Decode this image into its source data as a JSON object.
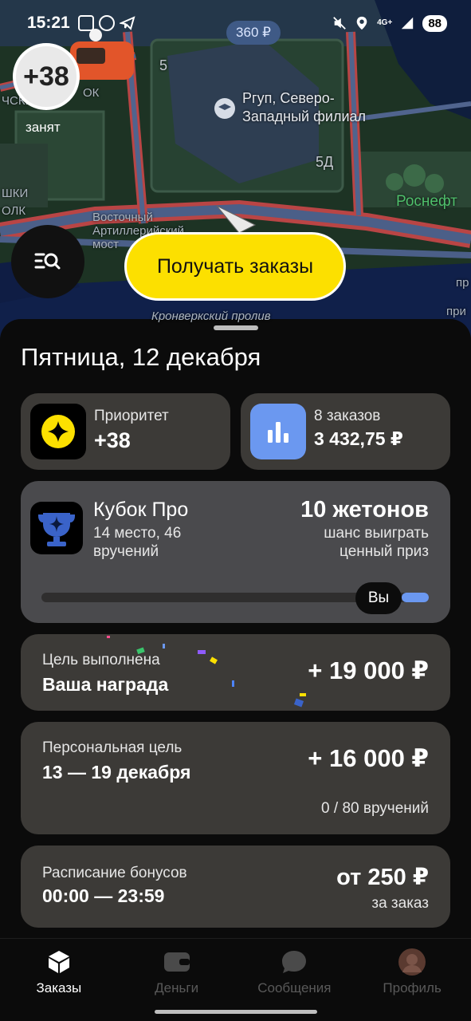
{
  "status_bar": {
    "time": "15:21",
    "battery": "88",
    "network": "4G+"
  },
  "map": {
    "price_pill": "360 ₽",
    "driver_status_value": "+38",
    "driver_status_label": "занят",
    "labels": {
      "number_5": "5",
      "university": "Ргуп, Северо-\nЗападный филиал",
      "building_5d": "5Д",
      "rosneft": "Роснефт",
      "street": "Восточный\nАртиллерийский\nмост",
      "strait": "Кронверкский пролив",
      "left_fragment_1": "ЧСКИ",
      "left_fragment_2": "ОК",
      "left_fragment_3": "ШКИ",
      "left_fragment_4": "ОЛК",
      "right_fragment_1": "пр",
      "right_fragment_2": "при"
    },
    "get_orders_button": "Получать заказы"
  },
  "sheet": {
    "date_title": "Пятница, 12 декабря",
    "priority": {
      "label": "Приоритет",
      "value": "+38"
    },
    "orders": {
      "label": "8 заказов",
      "value": "3 432,75 ₽"
    },
    "cup": {
      "title": "Кубок Про",
      "subtitle": "14 место, 46\nвручений",
      "tokens": "10 жетонов",
      "tokens_desc": "шанс выиграть\nценный приз",
      "you_badge": "Вы",
      "progress_fraction": 0.07
    },
    "goal_done": {
      "label": "Цель выполнена",
      "title": "Ваша награда",
      "amount": "+ 19 000 ₽"
    },
    "personal_goal": {
      "label": "Персональная цель",
      "dates": "13 — 19 декабря",
      "amount": "+ 16 000 ₽",
      "progress": "0 / 80 вручений"
    },
    "schedule": {
      "label": "Расписание бонусов",
      "time": "00:00 — 23:59",
      "amount": "от 250 ₽",
      "per": "за заказ"
    }
  },
  "bottom_nav": {
    "items": [
      {
        "label": "Заказы",
        "active": true
      },
      {
        "label": "Деньги",
        "active": false
      },
      {
        "label": "Сообщения",
        "active": false
      },
      {
        "label": "Профиль",
        "active": false
      }
    ]
  },
  "colors": {
    "accent_yellow": "#fce000",
    "card_bg": "#3c3a37",
    "orders_icon_blue": "#6b98f0",
    "progress_blue": "#6b98f0"
  }
}
